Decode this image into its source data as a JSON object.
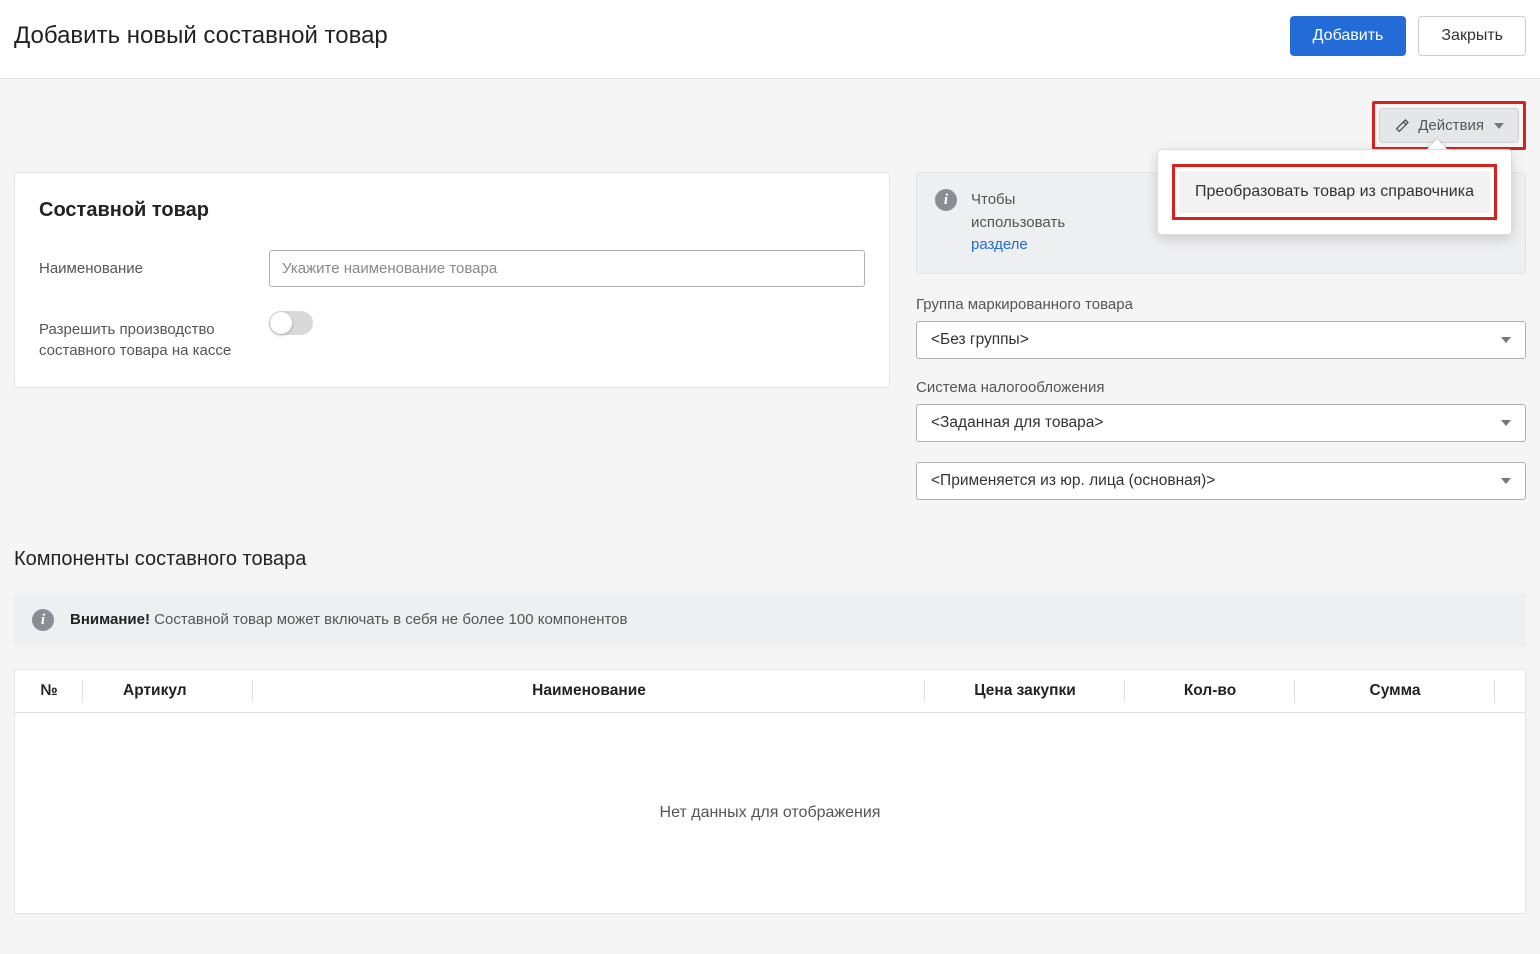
{
  "header": {
    "title": "Добавить новый составной товар",
    "add_button": "Добавить",
    "close_button": "Закрыть"
  },
  "actions": {
    "button_label": "Действия",
    "dropdown_item": "Преобразовать товар из справочника"
  },
  "left_panel": {
    "title": "Составной товар",
    "name_label": "Наименование",
    "name_placeholder": "Укажите наименование товара",
    "allow_label": "Разрешить производство составного товара на кассе"
  },
  "right_panel": {
    "info_prefix": "Чтобы",
    "info_mid": "использовать",
    "info_link": "разделе",
    "group_label": "Группа маркированного товара",
    "group_value": "<Без группы>",
    "tax_label": "Система налогообложения",
    "tax_value": "<Заданная для товара>",
    "applied_value": "<Применяется из юр. лица (основная)>"
  },
  "components": {
    "section_title": "Компоненты составного товара",
    "banner_bold": "Внимание!",
    "banner_text": " Составной товар может включать в себя не более 100 компонентов",
    "columns": {
      "num": "№",
      "article": "Артикул",
      "name": "Наименование",
      "price": "Цена закупки",
      "qty": "Кол-во",
      "sum": "Сумма"
    },
    "empty": "Нет данных для отображения"
  }
}
